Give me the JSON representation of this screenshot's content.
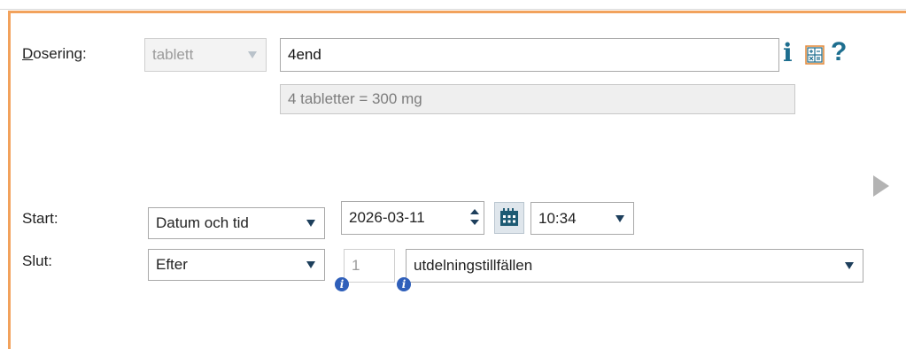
{
  "dosering": {
    "label_prefix": "D",
    "label_rest": "osering:",
    "unit_select": "tablett",
    "dose_input": "4end",
    "dose_summary": "4 tabletter = 300 mg"
  },
  "toolbar": {
    "info_glyph": "i",
    "help_glyph": "?"
  },
  "start": {
    "label": "Start:",
    "mode_select": "Datum och tid",
    "date": "2026-03-11",
    "time": "10:34"
  },
  "slut": {
    "label": "Slut:",
    "mode_select": "Efter",
    "count_placeholder": "1",
    "unit_select": "utdelningstillfällen",
    "info_glyph": "i"
  },
  "colors": {
    "accent_border": "#f2a25c",
    "icon_primary": "#1d6e8f",
    "caret": "#1d3f5c",
    "info_dot": "#2f5fba"
  },
  "icons": [
    "info-icon",
    "calculator-icon",
    "help-icon",
    "play-arrow-icon",
    "calendar-icon",
    "caret-down-icon"
  ]
}
